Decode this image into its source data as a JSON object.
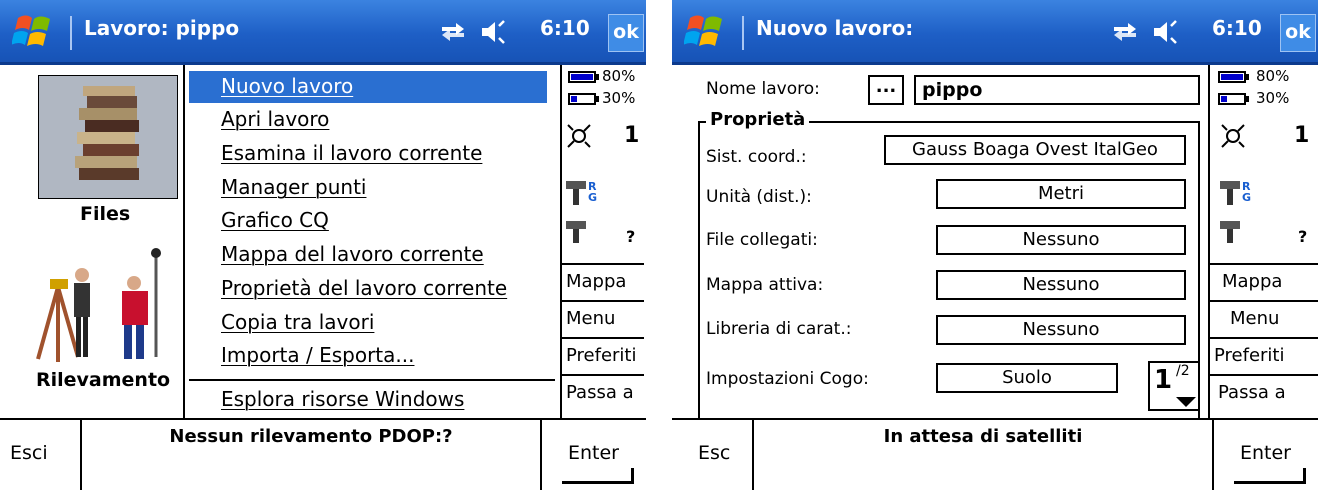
{
  "screens": [
    {
      "title": "Lavoro: pippo",
      "clock": "6:10",
      "ok": "ok",
      "tiles": [
        {
          "label": "Files",
          "icon": "files-books-icon"
        },
        {
          "label": "Rilevamento",
          "icon": "surveyors-icon"
        }
      ],
      "menu": {
        "selected_index": 0,
        "items": [
          "Nuovo lavoro",
          "Apri lavoro",
          "Esamina il lavoro corrente",
          "Manager punti",
          "Grafico CQ",
          "Mappa del lavoro corrente",
          "Proprietà del lavoro corrente",
          "Copia tra lavori",
          "Importa / Esporta...",
          "Esplora risorse Windows"
        ]
      },
      "status_panel": {
        "battery1": "80%",
        "battery2": "30%",
        "satellites": "1",
        "rtk_badge": "R\nG",
        "unknown": "?",
        "buttons": [
          "Mappa",
          "Menu",
          "Preferiti",
          "Passa a"
        ]
      },
      "bottom": {
        "left": "Esci",
        "status": "Nessun rilevamento  PDOP:?",
        "right": "Enter"
      }
    },
    {
      "title": "Nuovo lavoro:",
      "clock": "6:10",
      "ok": "ok",
      "form": {
        "name_label": "Nome lavoro:",
        "browse_button": "...",
        "name_value": "pippo",
        "group_label": "Proprietà",
        "rows": [
          {
            "label": "Sist. coord.:",
            "value": "Gauss Boaga Ovest ItalGeo"
          },
          {
            "label": "Unità (dist.):",
            "value": "Metri"
          },
          {
            "label": "File collegati:",
            "value": "Nessuno"
          },
          {
            "label": "Mappa attiva:",
            "value": "Nessuno"
          },
          {
            "label": "Libreria di carat.:",
            "value": "Nessuno"
          },
          {
            "label": "Impostazioni Cogo:",
            "value": "Suolo"
          }
        ],
        "page_current": "1",
        "page_total": "/2"
      },
      "status_panel": {
        "battery1": "80%",
        "battery2": "30%",
        "satellites": "1",
        "rtk_badge": "R\nG",
        "unknown": "?",
        "buttons": [
          "Mappa",
          "Menu",
          "Preferiti",
          "Passa a"
        ]
      },
      "bottom": {
        "left": "Esc",
        "status": "In attesa di satelliti",
        "right": "Enter"
      }
    }
  ],
  "colors": {
    "titlebar": "#1e5fc6",
    "selection": "#2a6fd1",
    "battery": "#0000cc"
  }
}
